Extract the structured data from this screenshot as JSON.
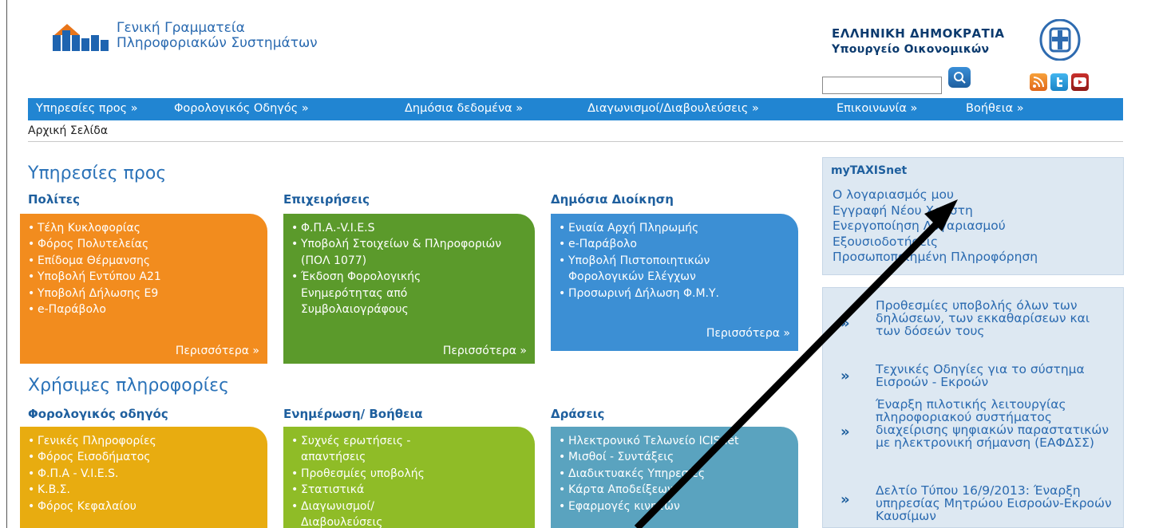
{
  "header": {
    "org_line1": "Γενική Γραμματεία",
    "org_line2": "Πληροφοριακών Συστημάτων",
    "rep_line1": "ΕΛΛΗΝΙΚΗ ΔΗΜΟΚΡΑΤΙΑ",
    "rep_line2": "Υπουργείο Οικονομικών",
    "search_value": ""
  },
  "nav": {
    "items": [
      {
        "label": "Υπηρεσίες προς »"
      },
      {
        "label": "Φορολογικός Οδηγός »"
      },
      {
        "label": "Δημόσια δεδομένα »"
      },
      {
        "label": "Διαγωνισμοί/Διαβουλεύσεις »"
      },
      {
        "label": "Επικοινωνία »"
      },
      {
        "label": "Βοήθεια »"
      }
    ],
    "breadcrumb": "Αρχική Σελίδα"
  },
  "services": {
    "title": "Υπηρεσίες προς",
    "columns": [
      {
        "title": "Πολίτες",
        "items": [
          "Τέλη Κυκλοφορίας",
          "Φόρος Πολυτελείας",
          "Επίδομα Θέρμανσης",
          "Υποβολή Εντύπου Α21",
          "Υποβολή Δήλωσης Ε9",
          "e-Παράβολο"
        ],
        "more": "Περισσότερα »"
      },
      {
        "title": "Επιχειρήσεις",
        "items": [
          "Φ.Π.Α.-V.I.E.S",
          "Υποβολή Στοιχείων & Πληροφοριών (ΠΟΛ 1077)",
          "Έκδοση Φορολογικής Ενημερότητας από Συμβολαιογράφους"
        ],
        "more": "Περισσότερα »"
      },
      {
        "title": "Δημόσια Διοίκηση",
        "items": [
          "Ενιαία Αρχή Πληρωμής",
          "e-Παράβολο",
          "Υποβολή Πιστοποιητικών Φορολογικών Ελέγχων",
          "Προσωρινή Δήλωση Φ.Μ.Υ."
        ],
        "more": "Περισσότερα »"
      }
    ]
  },
  "info": {
    "title": "Χρήσιμες πληροφορίες",
    "columns": [
      {
        "title": "Φορολογικός οδηγός",
        "items": [
          "Γενικές Πληροφορίες",
          "Φόρος Εισοδήματος",
          "Φ.Π.Α - V.I.E.S.",
          "Κ.Β.Σ.",
          "Φόρος Κεφαλαίου"
        ]
      },
      {
        "title": "Ενημέρωση/ Βοήθεια",
        "items": [
          "Συχνές ερωτήσεις - απαντήσεις",
          "Προθεσμίες υποβολής",
          "Στατιστικά",
          "Διαγωνισμοί/ Διαβουλεύσεις"
        ]
      },
      {
        "title": "Δράσεις",
        "items": [
          "Ηλεκτρονικό Τελωνείο ICISnet",
          "Μισθοί - Συντάξεις",
          "Διαδικτυακές Υπηρεσίες",
          "Κάρτα Αποδείξεων",
          "Εφαρμογές κινητών"
        ]
      }
    ]
  },
  "mytaxisnet": {
    "title": "myTAXISnet",
    "links": [
      "Ο λογαριασμός μου",
      "Εγγραφή Νέου Χρήστη",
      "Ενεργοποίηση Λογαριασμού",
      "Εξουσιοδοτήσεις",
      "Προσωποποιημένη Πληροφόρηση"
    ]
  },
  "news": [
    {
      "text": "Προθεσμίες υποβολής όλων των δηλώσεων, των εκκαθαρίσεων και των δόσεών τους"
    },
    {
      "text": "Τεχνικές Οδηγίες για το σύστημα Εισροών - Εκροών"
    },
    {
      "text": "Έναρξη πιλοτικής λειτουργίας πληροφοριακού συστήματος διαχείρισης ψηφιακών παραστατικών με ηλεκτρονική σήμανση (ΕΑΦΔΣΣ)"
    },
    {
      "text": "Δελτίο Τύπου 16/9/2013: Έναρξη υπηρεσίας Μητρώου Εισροών-Εκροών Καυσίμων"
    }
  ],
  "colors": {
    "nav": "#2185d2",
    "orange": "#f28c1e",
    "green": "#5b9a2b",
    "blue": "#3c8fd4",
    "yellow": "#e8ac10",
    "lime": "#8fbc27",
    "teal": "#5aa3bf",
    "panel": "#dde8f2"
  },
  "icons": [
    "logo-icon",
    "emblem-icon",
    "search-icon",
    "rss-icon",
    "twitter-icon",
    "youtube-icon",
    "chevron-right-icon"
  ]
}
